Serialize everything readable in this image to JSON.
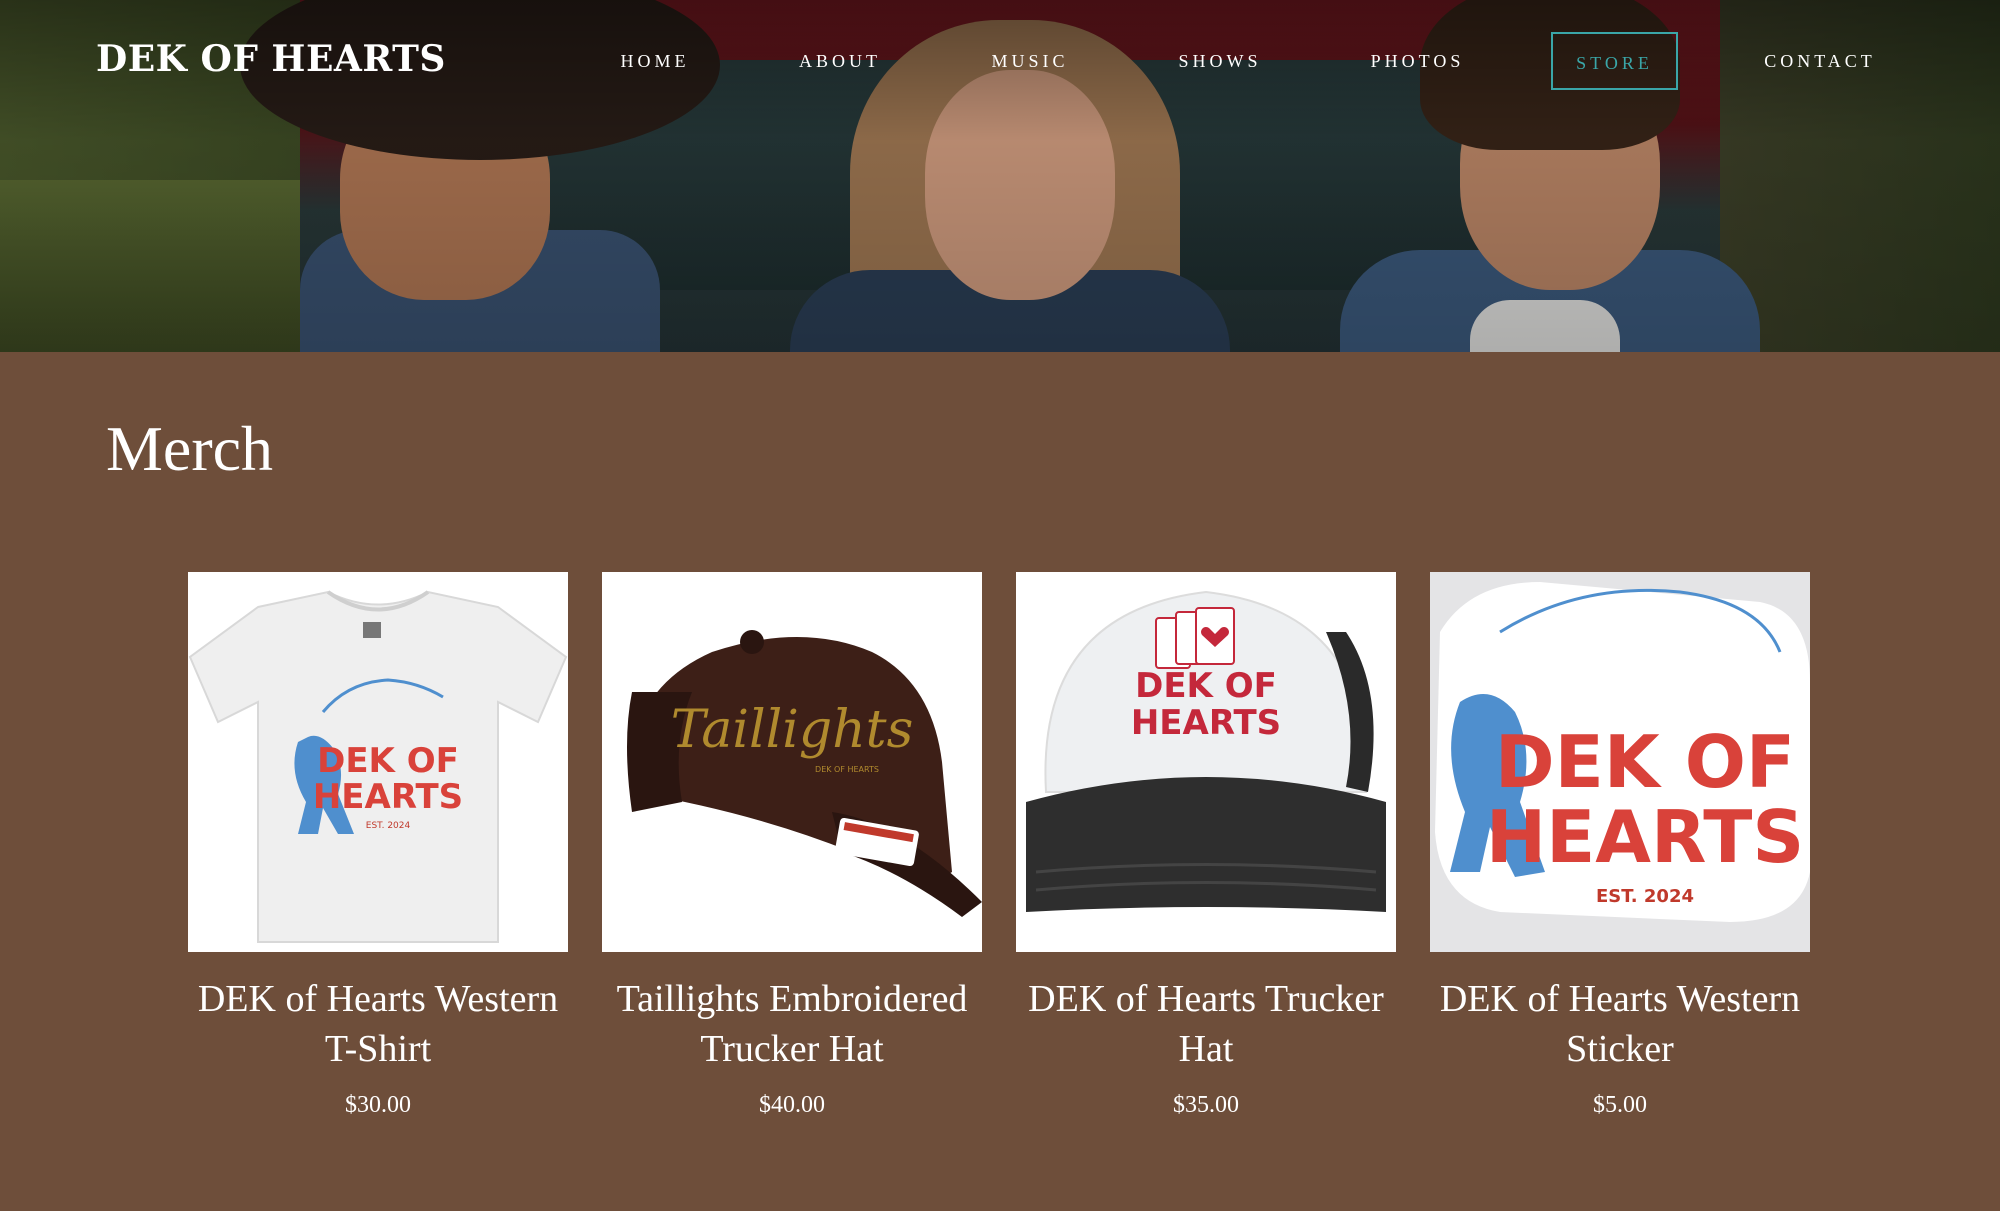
{
  "brand": "DEK OF HEARTS",
  "nav": {
    "items": [
      {
        "label": "HOME"
      },
      {
        "label": "ABOUT"
      },
      {
        "label": "MUSIC"
      },
      {
        "label": "SHOWS"
      },
      {
        "label": "PHOTOS"
      },
      {
        "label": "STORE",
        "active": true
      },
      {
        "label": "CONTACT"
      }
    ]
  },
  "page_title": "Merch",
  "products": [
    {
      "name": "DEK of Hearts Western T-Shirt",
      "price": "$30.00",
      "image_text": {
        "line1": "DEK OF",
        "line2": "HEARTS",
        "est": "EST. 2024"
      }
    },
    {
      "name": "Taillights Embroidered Trucker Hat",
      "price": "$40.00",
      "image_text": {
        "line1": "Taillights",
        "line2": "DEK OF HEARTS"
      }
    },
    {
      "name": "DEK of Hearts Trucker Hat",
      "price": "$35.00",
      "image_text": {
        "line1": "DEK OF",
        "line2": "HEARTS"
      }
    },
    {
      "name": "DEK of Hearts Western Sticker",
      "price": "$5.00",
      "image_text": {
        "line1": "DEK OF",
        "line2": "HEARTS",
        "est": "EST. 2024"
      }
    }
  ],
  "colors": {
    "background": "#6e4e3a",
    "accent": "#3aa6a8",
    "text": "#ffffff",
    "logo_red": "#d9423a",
    "logo_blue": "#4f8fce"
  }
}
